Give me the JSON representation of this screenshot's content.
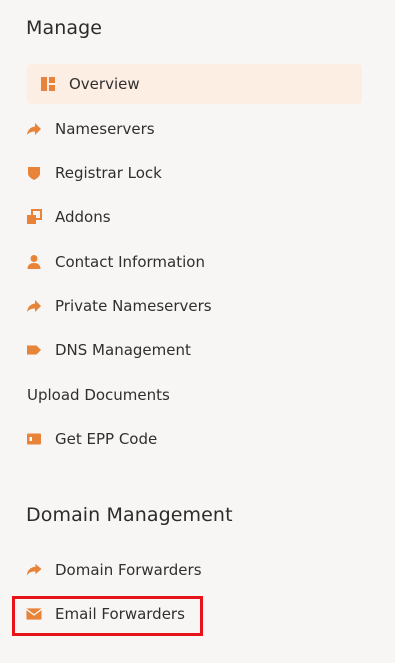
{
  "sections": {
    "manage": {
      "title": "Manage",
      "items": [
        {
          "label": "Overview",
          "icon": "dashboard-icon",
          "active": true
        },
        {
          "label": "Nameservers",
          "icon": "share-arrow-icon"
        },
        {
          "label": "Registrar Lock",
          "icon": "shield-icon"
        },
        {
          "label": "Addons",
          "icon": "addons-icon"
        },
        {
          "label": "Contact Information",
          "icon": "user-icon"
        },
        {
          "label": "Private Nameservers",
          "icon": "share-arrow-icon"
        },
        {
          "label": "DNS Management",
          "icon": "tag-icon"
        },
        {
          "label": "Upload Documents",
          "icon": ""
        },
        {
          "label": "Get EPP Code",
          "icon": "id-card-icon"
        }
      ]
    },
    "domain_management": {
      "title": "Domain Management",
      "items": [
        {
          "label": "Domain Forwarders",
          "icon": "forward-icon"
        },
        {
          "label": "Email Forwarders",
          "icon": "envelope-icon",
          "highlighted": true
        }
      ]
    }
  },
  "colors": {
    "accent": "#e8833a",
    "active_bg": "#fdeee3",
    "highlight_border": "#e8121b",
    "background": "#f8f6f4"
  }
}
